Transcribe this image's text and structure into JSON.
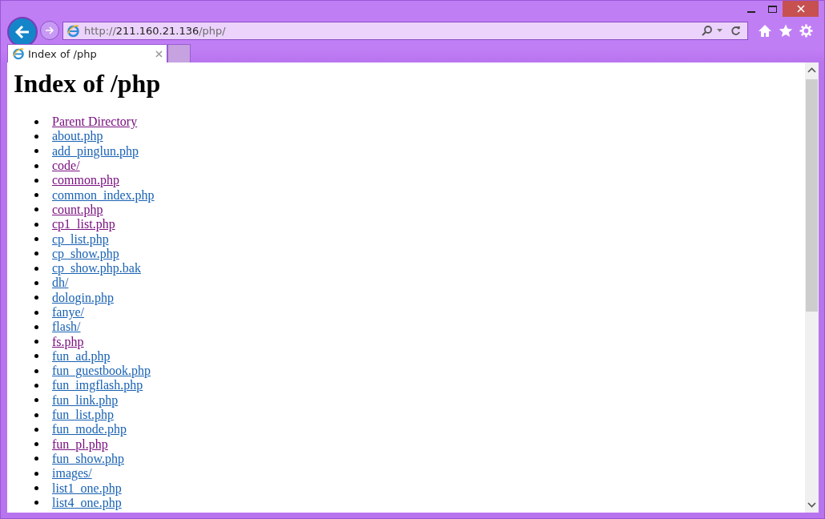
{
  "address_bar": {
    "scheme": "http://",
    "host": "211.160.21.136",
    "path": "/php/"
  },
  "tabs": [
    {
      "title": "Index of /php",
      "selected": true
    }
  ],
  "page": {
    "heading": "Index of /php",
    "links": [
      {
        "text": "Parent Directory",
        "visited": true
      },
      {
        "text": "about.php",
        "visited": false
      },
      {
        "text": "add_pinglun.php",
        "visited": false
      },
      {
        "text": "code/",
        "visited": true
      },
      {
        "text": "common.php",
        "visited": true
      },
      {
        "text": "common_index.php",
        "visited": false
      },
      {
        "text": "count.php",
        "visited": true
      },
      {
        "text": "cp1_list.php",
        "visited": true
      },
      {
        "text": "cp_list.php",
        "visited": false
      },
      {
        "text": "cp_show.php",
        "visited": false
      },
      {
        "text": "cp_show.php.bak",
        "visited": false
      },
      {
        "text": "dh/",
        "visited": false
      },
      {
        "text": "dologin.php",
        "visited": false
      },
      {
        "text": "fanye/",
        "visited": false
      },
      {
        "text": "flash/",
        "visited": false
      },
      {
        "text": "fs.php",
        "visited": true
      },
      {
        "text": "fun_ad.php",
        "visited": false
      },
      {
        "text": "fun_guestbook.php",
        "visited": false
      },
      {
        "text": "fun_imgflash.php",
        "visited": false
      },
      {
        "text": "fun_link.php",
        "visited": false
      },
      {
        "text": "fun_list.php",
        "visited": false
      },
      {
        "text": "fun_mode.php",
        "visited": false
      },
      {
        "text": "fun_pl.php",
        "visited": true
      },
      {
        "text": "fun_show.php",
        "visited": false
      },
      {
        "text": "images/",
        "visited": false
      },
      {
        "text": "list1_one.php",
        "visited": false
      },
      {
        "text": "list4_one.php",
        "visited": false
      }
    ]
  }
}
